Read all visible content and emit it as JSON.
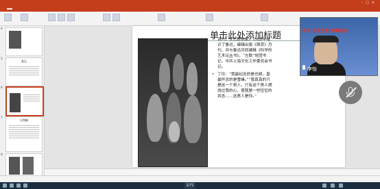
{
  "slide": {
    "title": "单击此处添加标题",
    "bullets": [
      "诗人，文艺理论家。1928年结识了鲁迅，编辑出版《萌芽》月刊，并与鲁迅共同编辑《科学的艺术论丛书》。“左联”党团书记，中共上海文化工作委员会书记。",
      "丁玲：“我最纪念的是也频，直最怀念的是雪峰。”“我真真的只是这一个男人，只有这个男人燃烧过我的心，使我是一些怔怔的状态……这男人是你。”"
    ]
  },
  "thumbnails": [
    {
      "num": "4",
      "title": ""
    },
    {
      "num": "5",
      "title": "柔石"
    },
    {
      "num": "6",
      "title": ""
    },
    {
      "num": "7",
      "title": "冯雪峰"
    },
    {
      "num": "8",
      "title": ""
    }
  ],
  "video": {
    "banner": "书与“文联互鉴”高峰论坛",
    "participant_name": "李怡"
  },
  "page_indicator": "1/71",
  "colors": {
    "accent": "#c43e1c"
  },
  "icons": [
    "microphone-icon",
    "mute-microphone-icon"
  ]
}
